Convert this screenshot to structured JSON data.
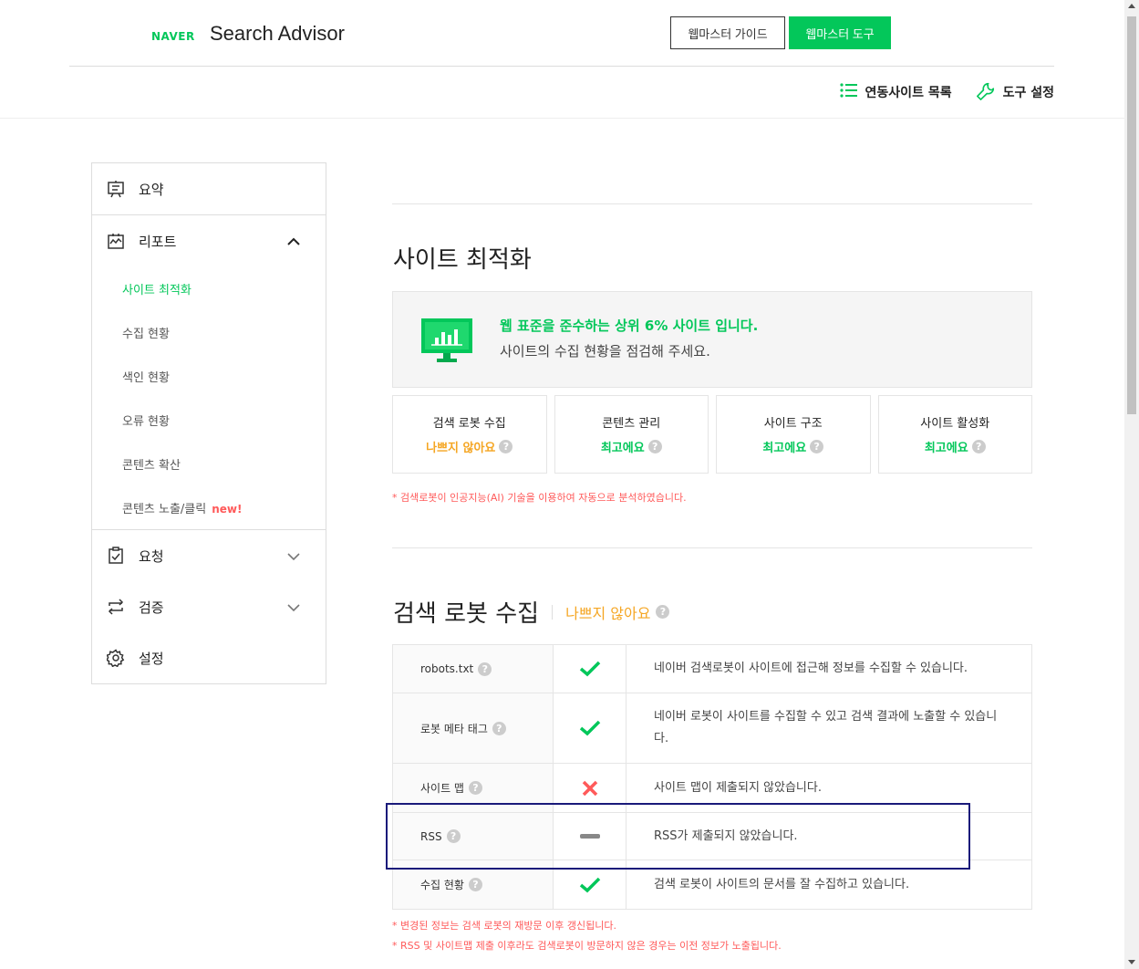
{
  "header": {
    "logo": "NAVER",
    "brand": "Search Advisor",
    "guide_button": "웹마스터 가이드",
    "tool_button": "웹마스터 도구",
    "site_list": "연동사이트 목록",
    "tool_settings": "도구 설정"
  },
  "sidebar": {
    "summary": "요약",
    "report": "리포트",
    "report_items": [
      {
        "label": "사이트 최적화"
      },
      {
        "label": "수집 현황"
      },
      {
        "label": "색인 현황"
      },
      {
        "label": "오류 현황"
      },
      {
        "label": "콘텐츠 확산"
      },
      {
        "label": "콘텐츠 노출/클릭",
        "badge": "new!"
      }
    ],
    "request": "요청",
    "verify": "검증",
    "settings": "설정"
  },
  "main": {
    "title": "사이트 최적화",
    "summary_title": "웹 표준을 준수하는 상위 6% 사이트 입니다.",
    "summary_sub": "사이트의 수집 현황을 점검해 주세요.",
    "cards": [
      {
        "title": "검색 로봇 수집",
        "status": "나쁘지 않아요",
        "color": "#f5a623"
      },
      {
        "title": "콘텐츠 관리",
        "status": "최고에요",
        "color": "#03c75a"
      },
      {
        "title": "사이트 구조",
        "status": "최고에요",
        "color": "#03c75a"
      },
      {
        "title": "사이트 활성화",
        "status": "최고에요",
        "color": "#03c75a"
      }
    ],
    "ai_note": "* 검색로봇이 인공지능(AI) 기술을 이용하여 자동으로 분석하였습니다.",
    "robot_title": "검색 로봇 수집",
    "robot_status": "나쁘지 않아요",
    "rows": [
      {
        "name": "robots.txt",
        "icon": "check-icon",
        "desc": "네이버 검색로봇이 사이트에 접근해 정보를 수집할 수 있습니다."
      },
      {
        "name": "로봇 메타 태그",
        "icon": "check-icon",
        "desc": "네이버 로봇이 사이트를 수집할 수 있고 검색 결과에 노출할 수 있습니다."
      },
      {
        "name": "사이트 맵",
        "icon": "x-icon",
        "desc": "사이트 맵이 제출되지 않았습니다."
      },
      {
        "name": "RSS",
        "icon": "dash-icon",
        "desc": "RSS가 제출되지 않았습니다."
      },
      {
        "name": "수집 현황",
        "icon": "check-icon",
        "desc": "검색 로봇이 사이트의 문서를 잘 수집하고 있습니다."
      }
    ],
    "note1": "* 변경된 정보는 검색 로봇의 재방문 이후 갱신됩니다.",
    "note2": "* RSS 및 사이트맵 제출 이후라도 검색로봇이 방문하지 않은 경우는 이전 정보가 노출됩니다."
  },
  "help_symbol": "?",
  "colors": {
    "accent": "#03c75a",
    "warn": "#f5a623",
    "error": "#ff5a5a"
  }
}
